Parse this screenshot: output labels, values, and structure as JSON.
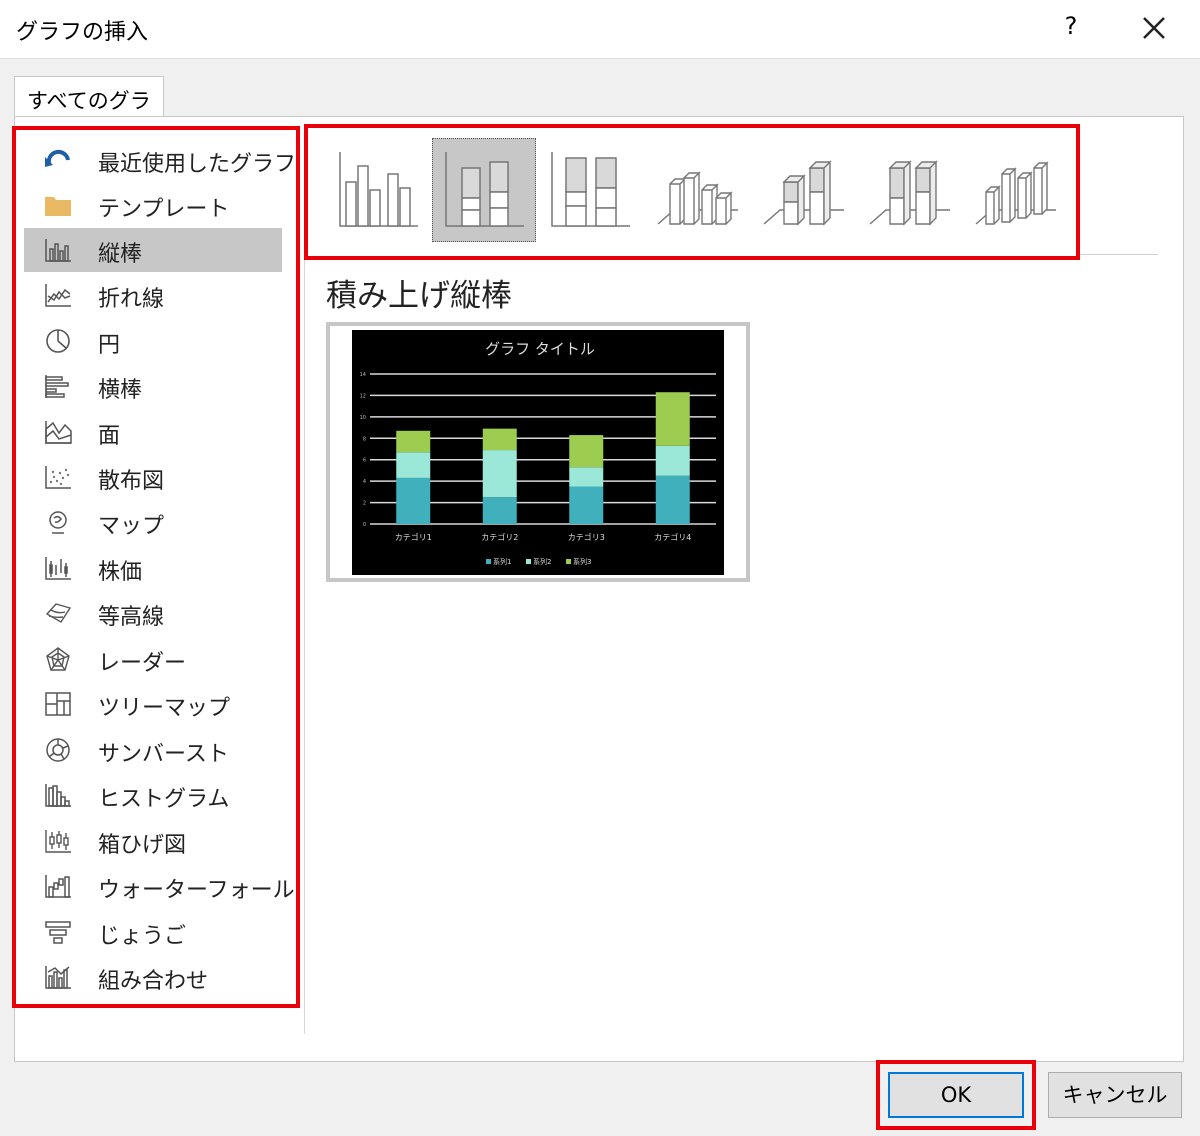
{
  "dialog": {
    "title": "グラフの挿入",
    "help": "?"
  },
  "tabs": [
    {
      "label": "すべてのグラフ"
    }
  ],
  "sidebar": {
    "items": [
      {
        "label": "最近使用したグラフ",
        "icon": "recent-icon"
      },
      {
        "label": "テンプレート",
        "icon": "folder-icon"
      },
      {
        "label": "縦棒",
        "icon": "column-chart-icon",
        "selected": true
      },
      {
        "label": "折れ線",
        "icon": "line-chart-icon"
      },
      {
        "label": "円",
        "icon": "pie-chart-icon"
      },
      {
        "label": "横棒",
        "icon": "bar-chart-icon"
      },
      {
        "label": "面",
        "icon": "area-chart-icon"
      },
      {
        "label": "散布図",
        "icon": "scatter-chart-icon"
      },
      {
        "label": "マップ",
        "icon": "map-chart-icon"
      },
      {
        "label": "株価",
        "icon": "stock-chart-icon"
      },
      {
        "label": "等高線",
        "icon": "surface-chart-icon"
      },
      {
        "label": "レーダー",
        "icon": "radar-chart-icon"
      },
      {
        "label": "ツリーマップ",
        "icon": "treemap-chart-icon"
      },
      {
        "label": "サンバースト",
        "icon": "sunburst-chart-icon"
      },
      {
        "label": "ヒストグラム",
        "icon": "histogram-chart-icon"
      },
      {
        "label": "箱ひげ図",
        "icon": "box-whisker-chart-icon"
      },
      {
        "label": "ウォーターフォール",
        "icon": "waterfall-chart-icon"
      },
      {
        "label": "じょうご",
        "icon": "funnel-chart-icon"
      },
      {
        "label": "組み合わせ",
        "icon": "combo-chart-icon"
      }
    ]
  },
  "subtypes": {
    "selected_index": 1,
    "names": [
      "clustered-column",
      "stacked-column",
      "100-stacked-column",
      "3d-clustered-column",
      "3d-stacked-column",
      "3d-100-stacked-column",
      "3d-column"
    ]
  },
  "selected_type_title": "積み上げ縦棒",
  "preview": {
    "chart_data": {
      "type": "bar",
      "stacked": true,
      "title": "グラフ タイトル",
      "categories": [
        "カテゴリ1",
        "カテゴリ2",
        "カテゴリ3",
        "カテゴリ4"
      ],
      "series": [
        {
          "name": "系列1",
          "values": [
            4.3,
            2.5,
            3.5,
            4.5
          ],
          "color": "#3fb0bc"
        },
        {
          "name": "系列2",
          "values": [
            2.4,
            4.4,
            1.8,
            2.8
          ],
          "color": "#9be8d8"
        },
        {
          "name": "系列3",
          "values": [
            2,
            2,
            3,
            5
          ],
          "color": "#9ccc50"
        }
      ],
      "yticks": [
        "0",
        "2",
        "4",
        "6",
        "8",
        "10",
        "12",
        "14"
      ],
      "ylim": [
        0,
        14
      ],
      "grid": true,
      "legend": "bottom",
      "background": "#000000"
    }
  },
  "buttons": {
    "ok": "OK",
    "cancel": "キャンセル"
  },
  "colors": {
    "highlight": "#e8000b",
    "selected_bg": "#c7c7c7",
    "accent": "#0078d7"
  }
}
